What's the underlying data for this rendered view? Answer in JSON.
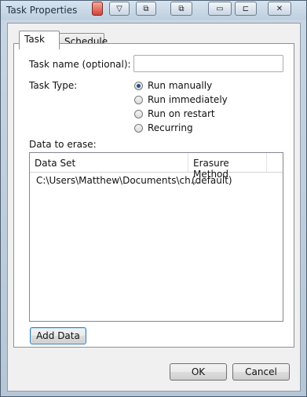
{
  "window": {
    "title": "Task Properties"
  },
  "tabs": [
    {
      "label": "Task",
      "active": true
    },
    {
      "label": "Schedule",
      "active": false
    }
  ],
  "form": {
    "task_name_label": "Task name (optional):",
    "task_name_value": "",
    "task_type_label": "Task Type:",
    "task_types": [
      {
        "label": "Run manually",
        "selected": true
      },
      {
        "label": "Run immediately",
        "selected": false
      },
      {
        "label": "Run on restart",
        "selected": false
      },
      {
        "label": "Recurring",
        "selected": false
      }
    ],
    "data_label": "Data to erase:"
  },
  "data_table": {
    "columns": [
      "Data Set",
      "Erasure Method"
    ],
    "rows": [
      [
        "C:\\Users\\Matthew\\Documents\\ch...",
        "(default)"
      ]
    ]
  },
  "buttons": {
    "add_data": "Add Data",
    "ok": "OK",
    "cancel": "Cancel"
  },
  "colors": {
    "radio_selected": "#1d4f91",
    "close_button": "#d0443a"
  }
}
